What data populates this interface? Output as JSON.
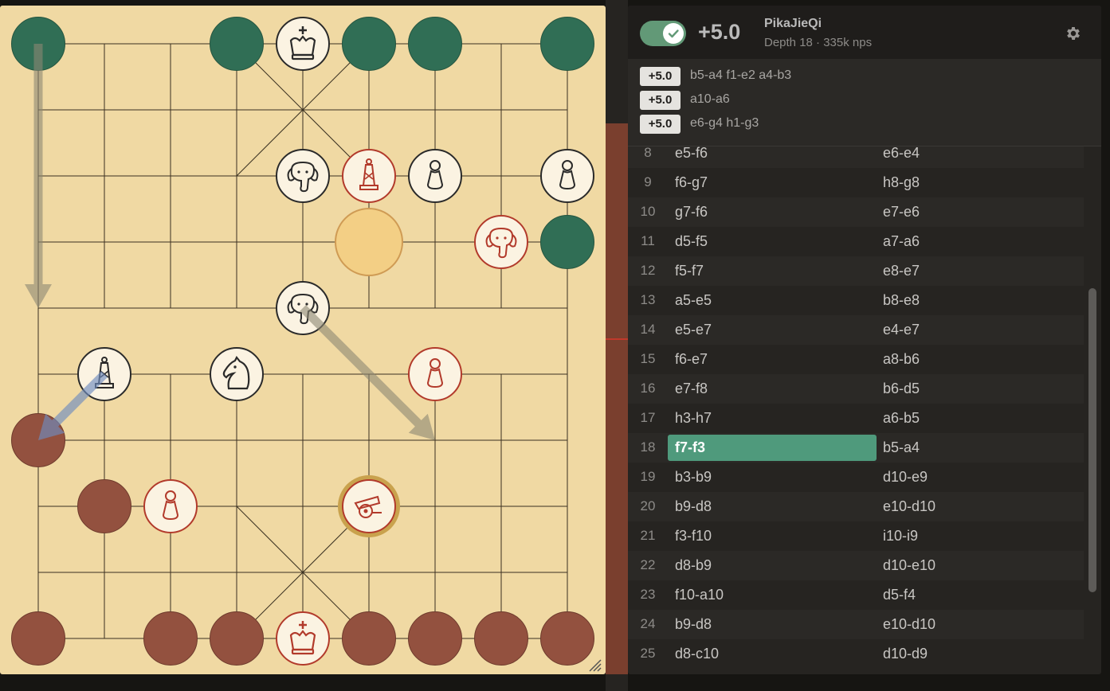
{
  "engine": {
    "enabled": true,
    "eval": "+5.0",
    "name": "PikaJieQi",
    "info": "Depth 18 · 335k nps",
    "settings_icon": "gear-icon"
  },
  "pv_lines": [
    {
      "score": "+5.0",
      "moves": "b5-a4 f1-e2 a4-b3"
    },
    {
      "score": "+5.0",
      "moves": "a10-a6"
    },
    {
      "score": "+5.0",
      "moves": "e6-g4 h1-g3"
    }
  ],
  "moves": [
    {
      "num": "8",
      "white": "e5-f6",
      "black": "e6-e4"
    },
    {
      "num": "9",
      "white": "f6-g7",
      "black": "h8-g8"
    },
    {
      "num": "10",
      "white": "g7-f6",
      "black": "e7-e6"
    },
    {
      "num": "11",
      "white": "d5-f5",
      "black": "a7-a6"
    },
    {
      "num": "12",
      "white": "f5-f7",
      "black": "e8-e7"
    },
    {
      "num": "13",
      "white": "a5-e5",
      "black": "b8-e8"
    },
    {
      "num": "14",
      "white": "e5-e7",
      "black": "e4-e7"
    },
    {
      "num": "15",
      "white": "f6-e7",
      "black": "a8-b6"
    },
    {
      "num": "16",
      "white": "e7-f8",
      "black": "b6-d5"
    },
    {
      "num": "17",
      "white": "h3-h7",
      "black": "a6-b5"
    },
    {
      "num": "18",
      "white": "f7-f3",
      "black": "b5-a4",
      "active": "white"
    },
    {
      "num": "19",
      "white": "b3-b9",
      "black": "d10-e9"
    },
    {
      "num": "20",
      "white": "b9-d8",
      "black": "e10-d10"
    },
    {
      "num": "21",
      "white": "f3-f10",
      "black": "i10-i9"
    },
    {
      "num": "22",
      "white": "d8-b9",
      "black": "d10-e10"
    },
    {
      "num": "23",
      "white": "f10-a10",
      "black": "d5-f4"
    },
    {
      "num": "24",
      "white": "b9-d8",
      "black": "e10-d10"
    },
    {
      "num": "25",
      "white": "d8-c10",
      "black": "d10-d9"
    }
  ],
  "board": {
    "colors": {
      "board": "#f0d9a3",
      "line": "#3a3020",
      "ghost_top": "#306e55",
      "ghost_bottom": "#93513f",
      "highlight": "#f3cf85",
      "accent": "#4f9a7c"
    },
    "pieces": [
      {
        "side": "dark",
        "type": "king",
        "file": 4,
        "rank": 0
      },
      {
        "side": "dark",
        "type": "elephant",
        "file": 4,
        "rank": 2
      },
      {
        "side": "red",
        "type": "advisor",
        "file": 5,
        "rank": 2
      },
      {
        "side": "dark",
        "type": "pawn",
        "file": 6,
        "rank": 2
      },
      {
        "side": "dark",
        "type": "pawn",
        "file": 8,
        "rank": 2
      },
      {
        "side": "red",
        "type": "elephant",
        "file": 7,
        "rank": 3
      },
      {
        "side": "dark",
        "type": "elephant",
        "file": 4,
        "rank": 4
      },
      {
        "side": "dark",
        "type": "advisor",
        "file": 1,
        "rank": 5
      },
      {
        "side": "dark",
        "type": "horse",
        "file": 3,
        "rank": 5
      },
      {
        "side": "red",
        "type": "pawn",
        "file": 6,
        "rank": 5
      },
      {
        "side": "red",
        "type": "pawn",
        "file": 2,
        "rank": 7
      },
      {
        "side": "red",
        "type": "cannon",
        "file": 5,
        "rank": 7,
        "selected": true
      },
      {
        "side": "red",
        "type": "king",
        "file": 4,
        "rank": 9
      }
    ],
    "ghosts": [
      {
        "color": "green",
        "file": 0,
        "rank": 0
      },
      {
        "color": "green",
        "file": 3,
        "rank": 0
      },
      {
        "color": "green",
        "file": 5,
        "rank": 0
      },
      {
        "color": "green",
        "file": 6,
        "rank": 0
      },
      {
        "color": "green",
        "file": 8,
        "rank": 0
      },
      {
        "color": "green",
        "file": 8,
        "rank": 3
      },
      {
        "color": "red",
        "file": 0,
        "rank": 6
      },
      {
        "color": "red",
        "file": 1,
        "rank": 7
      },
      {
        "color": "red",
        "file": 0,
        "rank": 9
      },
      {
        "color": "red",
        "file": 2,
        "rank": 9
      },
      {
        "color": "red",
        "file": 3,
        "rank": 9
      },
      {
        "color": "red",
        "file": 5,
        "rank": 9
      },
      {
        "color": "red",
        "file": 6,
        "rank": 9
      },
      {
        "color": "red",
        "file": 7,
        "rank": 9
      },
      {
        "color": "red",
        "file": 8,
        "rank": 9
      }
    ],
    "last_move_square": {
      "file": 5,
      "rank": 3
    },
    "arrows": [
      {
        "from": {
          "file": 0,
          "rank": 0
        },
        "to": {
          "file": 0,
          "rank": 4
        },
        "color": "gray"
      },
      {
        "from": {
          "file": 4,
          "rank": 4
        },
        "to": {
          "file": 6,
          "rank": 6
        },
        "color": "gray"
      },
      {
        "from": {
          "file": 1,
          "rank": 5
        },
        "to": {
          "file": 0,
          "rank": 6
        },
        "color": "blue"
      }
    ]
  }
}
